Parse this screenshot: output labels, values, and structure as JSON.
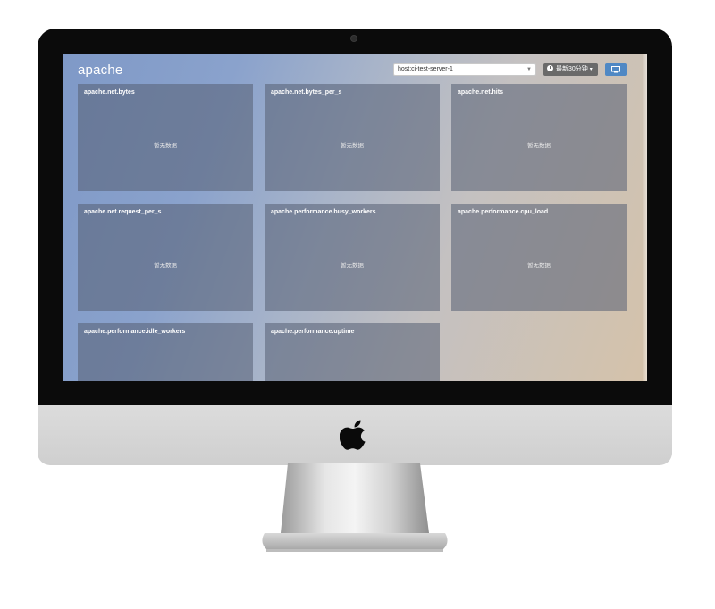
{
  "app": {
    "title": "apache"
  },
  "toolbar": {
    "host_value": "host:ci-test-server-1",
    "time_range_label": "最新30分钟",
    "clock_icon": "clock-icon",
    "monitor_icon": "monitor-icon"
  },
  "panels": [
    {
      "title": "apache.net.bytes",
      "empty_text": "暂无数据"
    },
    {
      "title": "apache.net.bytes_per_s",
      "empty_text": "暂无数据"
    },
    {
      "title": "apache.net.hits",
      "empty_text": "暂无数据"
    },
    {
      "title": "apache.net.request_per_s",
      "empty_text": "暂无数据"
    },
    {
      "title": "apache.performance.busy_workers",
      "empty_text": "暂无数据"
    },
    {
      "title": "apache.performance.cpu_load",
      "empty_text": "暂无数据"
    },
    {
      "title": "apache.performance.idle_workers",
      "empty_text": ""
    },
    {
      "title": "apache.performance.uptime",
      "empty_text": ""
    }
  ],
  "colors": {
    "accent": "#4f88c4",
    "panel_bg": "#5f6b7d",
    "bezel": "#0b0b0b"
  }
}
